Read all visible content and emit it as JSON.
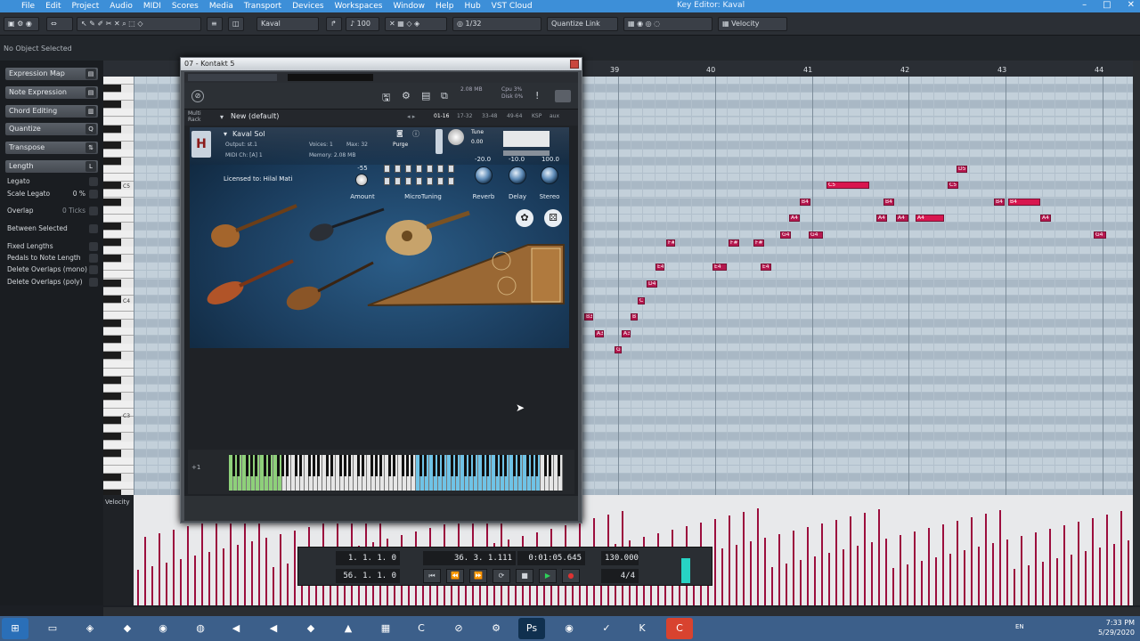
{
  "menu": [
    "File",
    "Edit",
    "Project",
    "Audio",
    "MIDI",
    "Scores",
    "Media",
    "Transport",
    "Devices",
    "Workspaces",
    "Window",
    "Help",
    "Hub",
    "VST Cloud"
  ],
  "window_title": "Key Editor: Kaval",
  "toolbar": {
    "track": "Kaval",
    "zoom": "100",
    "quantize": "1/32",
    "quantize_mode": "Quantize Link",
    "controller": "Velocity"
  },
  "info": {
    "status": "No Object Selected"
  },
  "left_panel": {
    "sections": [
      {
        "label": "Expression Map"
      },
      {
        "label": "Note Expression"
      },
      {
        "label": "Chord Editing"
      },
      {
        "label": "Quantize"
      },
      {
        "label": "Transpose"
      },
      {
        "label": "Length"
      }
    ],
    "length_options": [
      {
        "label": "Legato"
      },
      {
        "label": "Scale Legato",
        "value": "0 %"
      },
      {
        "label": "Overlap",
        "value": "0 Ticks"
      },
      {
        "label": "Between Selected"
      },
      {
        "label": "Fixed Lengths"
      },
      {
        "label": "Pedals to Note Length"
      },
      {
        "label": "Delete Overlaps (mono)"
      },
      {
        "label": "Delete Overlaps (poly)"
      }
    ]
  },
  "ruler": {
    "bars": [
      "39",
      "40",
      "41",
      "42",
      "43",
      "44"
    ]
  },
  "keys": {
    "labels": [
      "C5",
      "C4",
      "C3"
    ]
  },
  "velocity_label": "Velocity",
  "kontakt": {
    "title": "07 - Kontakt 5",
    "multi_rack": "Multi Rack",
    "preset": "New (default)",
    "ranges": [
      "01-16",
      "17-32",
      "33-48",
      "49-64",
      "KSP",
      "aux"
    ],
    "cpu": "Cpu 3%",
    "disk": "Disk 0%",
    "memory_top": "2.08 MB",
    "instrument": {
      "name": "Kaval Sol",
      "output": "Output: st.1",
      "voices": "Voices: 1",
      "max": "Max: 32",
      "purge": "Purge",
      "midi": "MIDI Ch: [A] 1",
      "memory": "Memory: 2.08 MB",
      "tune_label": "Tune",
      "tune_value": "0.00",
      "licensed": "Licensed to: Hilal Mati",
      "amount_value": "-55",
      "amount_label": "Amount",
      "microtuning_label": "MicroTuning",
      "reverb_value": "-20.0",
      "reverb_label": "Reverb",
      "delay_value": "-10.0",
      "delay_label": "Delay",
      "stereo_value": "100.0",
      "stereo_label": "Stereo"
    }
  },
  "transport": {
    "left_locator": "1. 1. 1.   0",
    "right_locator": "56. 1. 1.   0",
    "position": "36. 3. 1.111",
    "time": "0:01:05.645",
    "tempo": "130.000",
    "signature": "4/4"
  },
  "clock": {
    "time": "7:33 PM",
    "date": "5/29/2020"
  },
  "lang": "EN",
  "notes": [
    {
      "label": "D5"
    },
    {
      "label": "C5"
    },
    {
      "label": "C5"
    },
    {
      "label": "B4"
    },
    {
      "label": "B4"
    },
    {
      "label": "B4"
    },
    {
      "label": "B4"
    },
    {
      "label": "A4"
    },
    {
      "label": "A4"
    },
    {
      "label": "A4"
    },
    {
      "label": "A4"
    },
    {
      "label": "A4"
    },
    {
      "label": "G4"
    },
    {
      "label": "G4"
    },
    {
      "label": "G4"
    },
    {
      "label": "F#"
    },
    {
      "label": "F#"
    },
    {
      "label": "F#"
    },
    {
      "label": "E4"
    },
    {
      "label": "E4"
    },
    {
      "label": "E4"
    },
    {
      "label": "D4"
    },
    {
      "label": "C"
    },
    {
      "label": "B3"
    },
    {
      "label": "B"
    },
    {
      "label": "A3"
    },
    {
      "label": "A3"
    },
    {
      "label": "G"
    }
  ]
}
